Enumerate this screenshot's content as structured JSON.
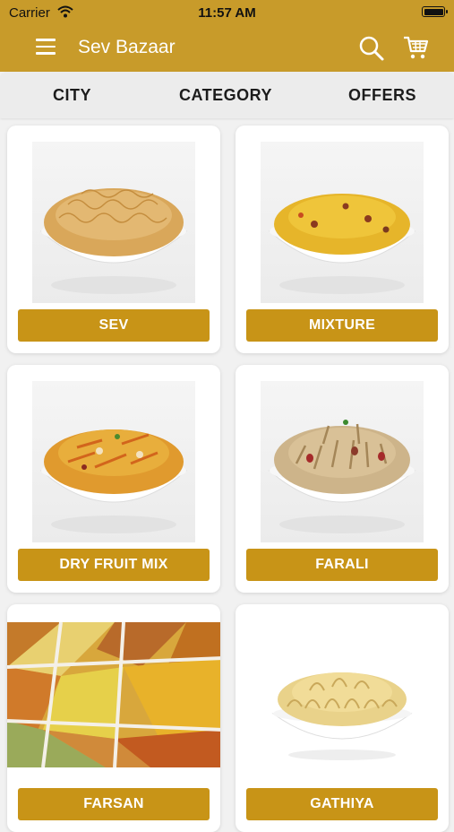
{
  "status_bar": {
    "carrier": "Carrier",
    "time": "11:57 AM"
  },
  "app_bar": {
    "title": "Sev Bazaar"
  },
  "tabs": [
    {
      "label": "CITY"
    },
    {
      "label": "CATEGORY"
    },
    {
      "label": "OFFERS"
    }
  ],
  "categories": [
    {
      "label": "SEV"
    },
    {
      "label": "MIXTURE"
    },
    {
      "label": "DRY FRUIT MIX"
    },
    {
      "label": "FARALI"
    },
    {
      "label": "FARSAN"
    },
    {
      "label": "GATHIYA"
    }
  ],
  "colors": {
    "brand": "#c89b2a",
    "button": "#c89417",
    "tab_bg": "#ececec",
    "page_bg": "#f1f1f1"
  }
}
